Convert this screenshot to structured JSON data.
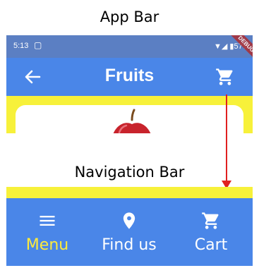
{
  "captions": {
    "app_bar": "App Bar",
    "navigation_bar": "Navigation Bar"
  },
  "status_bar": {
    "time": "5:13",
    "sim_icon": "sim-card-icon",
    "battery": "57%",
    "debug_banner": "DEBUG"
  },
  "app_bar": {
    "title": "Fruits",
    "back_icon": "arrow-back-icon",
    "cart_icon": "shopping-cart-icon"
  },
  "content": {
    "image": "apple-icon"
  },
  "navigation_bar": {
    "items": [
      {
        "label": "Menu",
        "icon": "menu-icon",
        "selected": true
      },
      {
        "label": "Find us",
        "icon": "location-pin-icon",
        "selected": false
      },
      {
        "label": "Cart",
        "icon": "shopping-cart-icon",
        "selected": false
      }
    ]
  },
  "colors": {
    "app_bar": "#4a86e8",
    "status_bar": "#5b7fc3",
    "background": "#f7f13a",
    "selected_label": "#ffeb3b",
    "unselected_label": "#ffffff",
    "arrow": "#e02020",
    "debug_ribbon": "#a8323a"
  }
}
